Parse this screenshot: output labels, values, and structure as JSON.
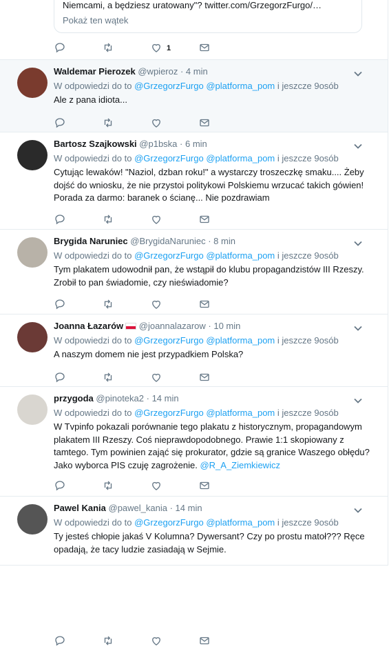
{
  "top": {
    "quote_text": "Niemcami, a będziesz uratowany\"? twitter.com/GrzegorzFurgo/…",
    "show_thread": "Pokaż ten wątek",
    "like_count": "1"
  },
  "reply_prefix": "W odpowiedzi do",
  "reply_to": "to",
  "mentions": [
    "@GrzegorzFurgo",
    "@platforma_pom"
  ],
  "reply_suffix": "i jeszcze 9osób",
  "tweets": [
    {
      "name": "Waldemar Pierozek",
      "handle": "@wpieroz",
      "time": "· 4 min",
      "text": "Ale z pana idiota..."
    },
    {
      "name": "Bartosz Szajkowski",
      "handle": "@p1bska",
      "time": "· 6 min",
      "text": "Cytując lewaków! \"Naziol, dzban roku!\" a wystarczy troszeczkę smaku.... Żeby dojść do wniosku, że nie przystoi politykowi Polskiemu wrzucać takich gówien! Porada za darmo: baranek o ścianę... Nie pozdrawiam"
    },
    {
      "name": "Brygida Naruniec",
      "handle": "@BrygidaNaruniec",
      "time": "· 8 min",
      "text": "Tym plakatem udowodnił pan, że wstąpił do klubu propagandzistów III Rzeszy. Zrobił to pan świadomie, czy nieświadomie?"
    },
    {
      "name": "Joanna Łazarów",
      "handle": "@joannalazarow",
      "time": "· 10 min",
      "text": "A naszym domem nie jest przypadkiem Polska?"
    },
    {
      "name": "przygoda",
      "handle": "@pinoteka2",
      "time": "· 14 min",
      "text": "W Tvpinfo pokazali porównanie tego plakatu z historycznym, propagandowym plakatem III Rzeszy. Coś nieprawdopodobnego.  Prawie 1:1 skopiowany z tamtego. Tym powinien zająć się prokurator, gdzie są granice Waszego obłędu? Jako wyborca PIS czuję zagrożenie.",
      "mention": "@R_A_Ziemkiewicz"
    },
    {
      "name": "Pawel Kania",
      "handle": "@pawel_kania",
      "time": "· 14 min",
      "text": "Ty jesteś chłopie jakaś V Kolumna? Dywersant? Czy po prostu matoł??? Ręce opadają, że tacy ludzie zasiadają w Sejmie."
    }
  ],
  "colors": {
    "link": "#1da1f2",
    "muted": "#657786",
    "highlight_bg": "#f5f8fa"
  }
}
